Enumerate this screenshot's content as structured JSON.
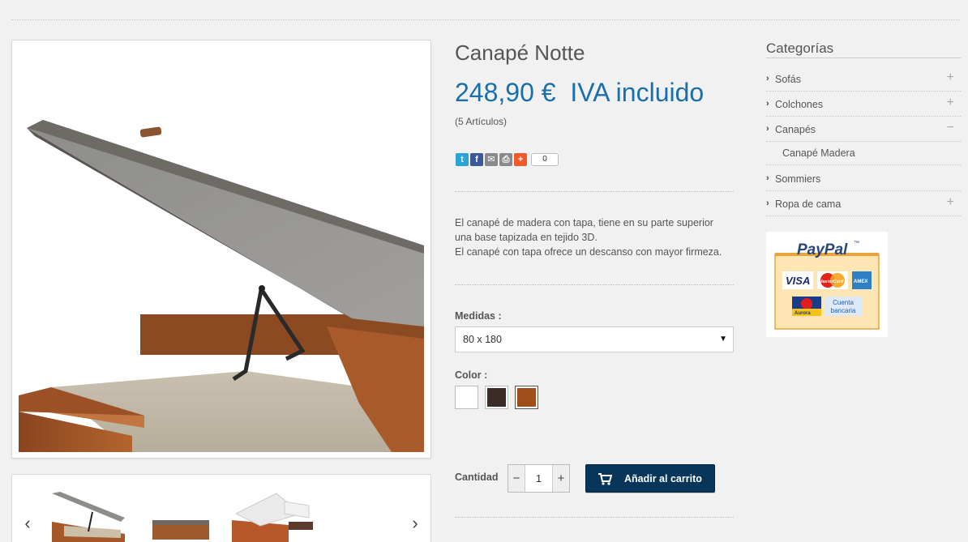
{
  "product": {
    "title": "Canapé Notte",
    "price": "248,90 €  IVA incluido",
    "stock": "(5 Artículos)",
    "share_count": "0",
    "description_lines": [
      "El canapé de madera con tapa, tiene en su parte superior",
      "una base tapizada en tejido 3D.",
      "El canapé con tapa ofrece un descanso con mayor firmeza."
    ]
  },
  "share_icons": [
    {
      "name": "twitter-icon",
      "color": "#2aa3d8",
      "glyph": "t"
    },
    {
      "name": "facebook-icon",
      "color": "#3b5998",
      "glyph": "f"
    },
    {
      "name": "email-icon",
      "color": "#8a8a8a",
      "glyph": "✉"
    },
    {
      "name": "print-icon",
      "color": "#8a8a8a",
      "glyph": "⎙"
    },
    {
      "name": "addthis-plus-icon",
      "color": "#f05a28",
      "glyph": "+"
    }
  ],
  "options": {
    "size_label": "Medidas :",
    "size_value": "80 x 180",
    "color_label": "Color :",
    "colors": [
      "#ffffff",
      "#3a2b26",
      "#a04d1c"
    ],
    "selected_color_index": 2
  },
  "cart": {
    "qty_label": "Cantidad",
    "qty_value": "1",
    "minus": "−",
    "plus": "+",
    "add_label": "Añadir al carrito"
  },
  "sidebar": {
    "title": "Categorías",
    "items": [
      {
        "label": "Sofás",
        "toggle": "+"
      },
      {
        "label": "Colchones",
        "toggle": "+"
      },
      {
        "label": "Canapés",
        "toggle": "−"
      },
      {
        "label": "Sommiers",
        "toggle": ""
      },
      {
        "label": "Ropa de cama",
        "toggle": "+"
      }
    ],
    "sub_items": [
      {
        "label": "Canapé Madera"
      }
    ]
  },
  "payment": {
    "brand": "PayPal",
    "brand_mark": "™",
    "cards": [
      "VISA",
      "MasterCard",
      "AMEX"
    ],
    "aurora": "Aurora",
    "bank_line1": "Cuenta",
    "bank_line2": "bancaria"
  },
  "gallery": {
    "prev": "‹",
    "next": "›"
  },
  "colors": {
    "accent_blue": "#1a6faa",
    "cart_button": "#07365a"
  }
}
